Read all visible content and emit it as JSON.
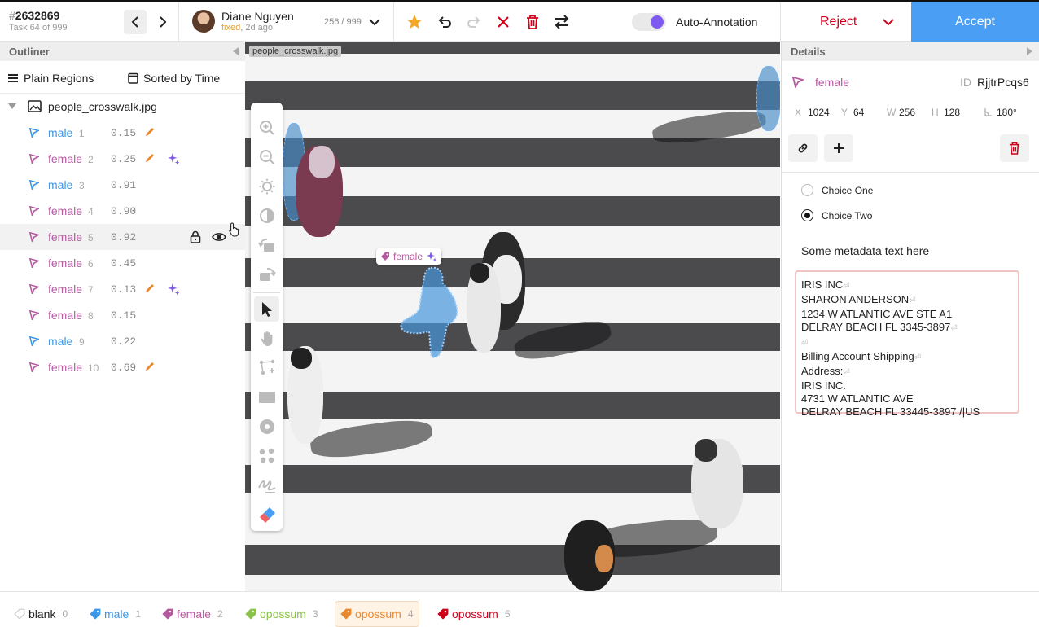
{
  "header": {
    "task_hash": "#",
    "task_id": "2632869",
    "task_sub": "Task 64 of 999",
    "user_name": "Diane Nguyen",
    "user_status": "fixed",
    "user_time": ", 2d ago",
    "counter": "256 / 999",
    "toggle_label": "Auto-Annotation",
    "reject": "Reject",
    "accept": "Accept"
  },
  "outliner": {
    "title": "Outliner",
    "group_label": "Plain Regions",
    "sort_label": "Sorted by Time",
    "file": "people_crosswalk.jpg",
    "regions": [
      {
        "label": "male",
        "idx": "1",
        "score": "0.15",
        "color": "#3c96e6",
        "pencil": true,
        "spark": false
      },
      {
        "label": "female",
        "idx": "2",
        "score": "0.25",
        "color": "#b65aa0",
        "pencil": true,
        "spark": true
      },
      {
        "label": "male",
        "idx": "3",
        "score": "0.91",
        "color": "#3c96e6",
        "pencil": false,
        "spark": false
      },
      {
        "label": "female",
        "idx": "4",
        "score": "0.90",
        "color": "#b65aa0",
        "pencil": false,
        "spark": false
      },
      {
        "label": "female",
        "idx": "5",
        "score": "0.92",
        "color": "#b65aa0",
        "pencil": false,
        "spark": false,
        "hover": true
      },
      {
        "label": "female",
        "idx": "6",
        "score": "0.45",
        "color": "#b65aa0",
        "pencil": false,
        "spark": false
      },
      {
        "label": "female",
        "idx": "7",
        "score": "0.13",
        "color": "#b65aa0",
        "pencil": true,
        "spark": true
      },
      {
        "label": "female",
        "idx": "8",
        "score": "0.15",
        "color": "#b65aa0",
        "pencil": false,
        "spark": false
      },
      {
        "label": "male",
        "idx": "9",
        "score": "0.22",
        "color": "#3c96e6",
        "pencil": false,
        "spark": false
      },
      {
        "label": "female",
        "idx": "10",
        "score": "0.69",
        "color": "#b65aa0",
        "pencil": true,
        "spark": false
      }
    ]
  },
  "canvas": {
    "file_tag": "people_crosswalk.jpg",
    "region_label": "female"
  },
  "details": {
    "title": "Details",
    "label": "female",
    "id_label": "ID",
    "id_value": "RjjtrPcqs6",
    "x_label": "X",
    "x": "1024",
    "y_label": "Y",
    "y": "64",
    "w_label": "W",
    "w": "256",
    "h_label": "H",
    "h": "128",
    "angle": "180°",
    "choice_one": "Choice One",
    "choice_two": "Choice Two",
    "meta": "Some metadata text here",
    "text_lines": [
      {
        "t": "IRIS INC",
        "br": true
      },
      {
        "t": "SHARON ANDERSON",
        "br": true
      },
      {
        "t": "1234 W ATLANTIC AVE STE A1",
        "br": false
      },
      {
        "t": "DELRAY BEACH FL 3345-3897",
        "br": true
      },
      {
        "t": "",
        "br": true
      },
      {
        "t": "Billing Account Shipping",
        "br": true
      },
      {
        "t": "Address:",
        "br": true
      },
      {
        "t": "IRIS INC.",
        "br": false
      },
      {
        "t": "4731 W ATLANTIC AVE",
        "br": false
      },
      {
        "t": "DELRAY BEACH FL 33445-3897 /|US",
        "br": false
      }
    ]
  },
  "labels": [
    {
      "name": "blank",
      "count": "0",
      "color": "#cccccc"
    },
    {
      "name": "male",
      "count": "1",
      "color": "#3c96e6"
    },
    {
      "name": "female",
      "count": "2",
      "color": "#b65aa0"
    },
    {
      "name": "opossum",
      "count": "3",
      "color": "#8bc34a"
    },
    {
      "name": "opossum",
      "count": "4",
      "color": "#e9892f",
      "selected": true
    },
    {
      "name": "opossum",
      "count": "5",
      "color": "#d0021b"
    }
  ]
}
